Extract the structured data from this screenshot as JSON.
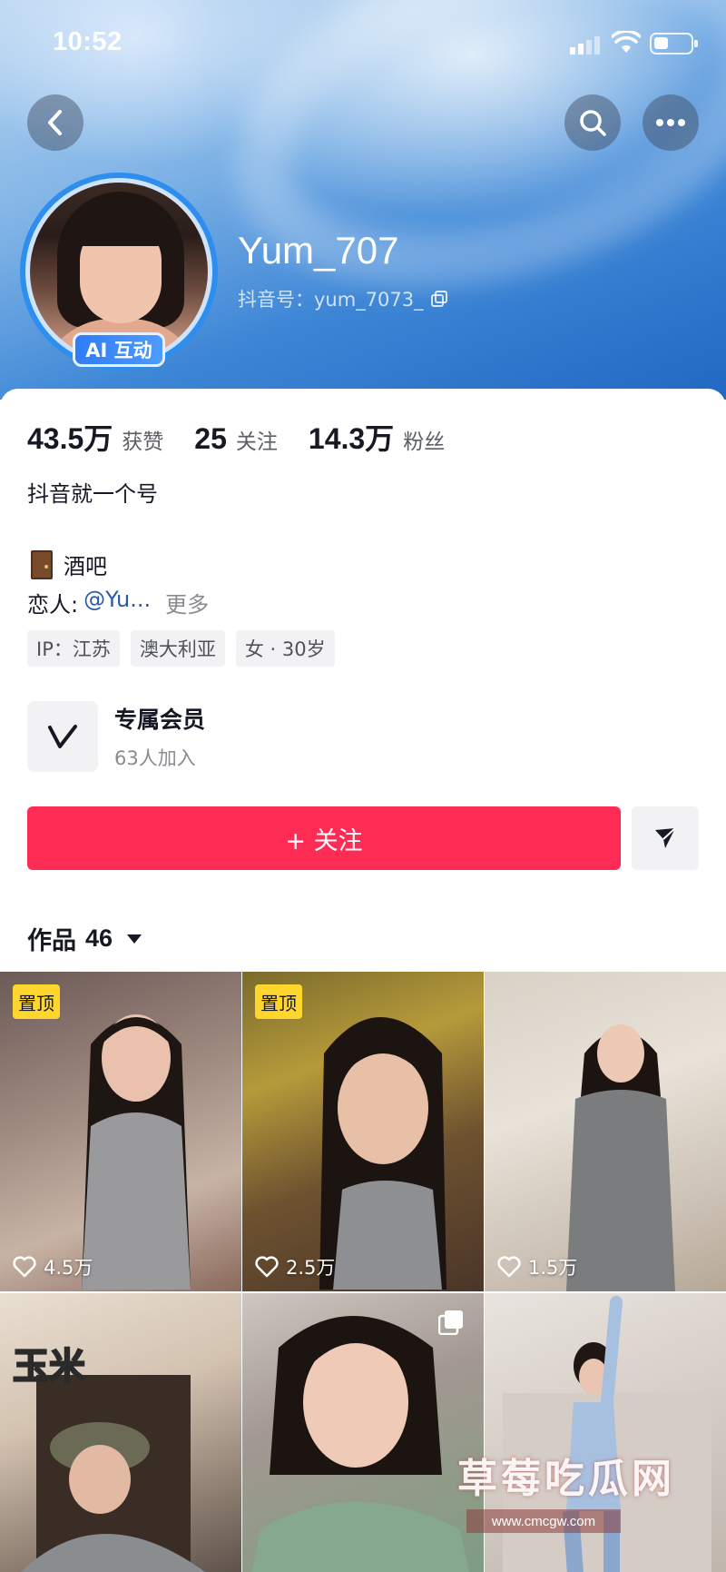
{
  "status_bar": {
    "time": "10:52"
  },
  "profile": {
    "username": "Yum_707",
    "douyin_id": "抖音号：yum_7073_",
    "ai_badge": "AI 互动",
    "stats": [
      {
        "value": "43.5万",
        "label": "获赞"
      },
      {
        "value": "25",
        "label": "关注"
      },
      {
        "value": "14.3万",
        "label": "粉丝"
      }
    ],
    "bio": "抖音就一个号",
    "bar_text": "酒吧",
    "lover_prefix": "恋人:",
    "lover_mention": "@Yu...",
    "more": "更多",
    "tags": [
      "IP：江苏",
      "澳大利亚",
      "女 · 30岁"
    ]
  },
  "membership": {
    "title": "专属会员",
    "subtitle": "63人加入"
  },
  "actions": {
    "follow_label": "+ 关注"
  },
  "works": {
    "label": "作品",
    "count": "46"
  },
  "grid": [
    {
      "pinned": "置顶",
      "likes": "4.5万"
    },
    {
      "pinned": "置顶",
      "likes": "2.5万"
    },
    {
      "pinned": "",
      "likes": "1.5万"
    },
    {
      "overlay_text": "玉米"
    },
    {},
    {}
  ],
  "watermark": {
    "main": "草莓吃瓜网",
    "sub": "www.cmcgw.com"
  },
  "colors": {
    "accent": "#fe2c55",
    "pin_badge": "#ffd62e",
    "ai_badge": "#2f7cf6",
    "mention": "#2a5aa8"
  },
  "icons": [
    "back-icon",
    "search-icon",
    "more-icon",
    "copy-icon",
    "door-icon",
    "member-v-icon",
    "share-icon",
    "caret-down-icon",
    "heart-icon",
    "multi-image-icon"
  ]
}
